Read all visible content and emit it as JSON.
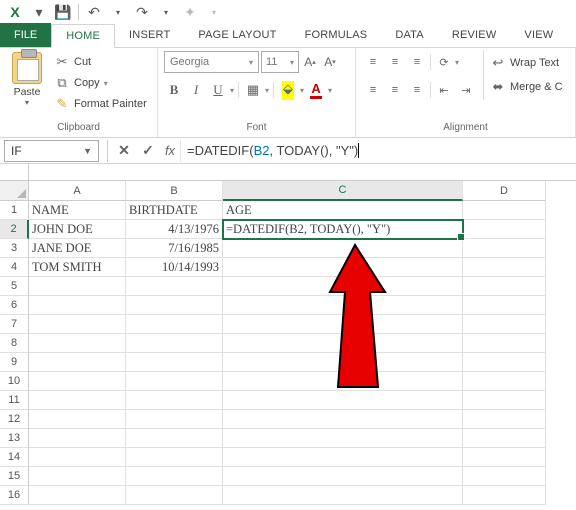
{
  "qat": {
    "excel": "X",
    "save": "💾",
    "undo": "↶",
    "redo": "↷"
  },
  "tabs": {
    "file": "FILE",
    "home": "HOME",
    "insert": "INSERT",
    "page_layout": "PAGE LAYOUT",
    "formulas": "FORMULAS",
    "data": "DATA",
    "review": "REVIEW",
    "view": "VIEW"
  },
  "ribbon": {
    "clipboard": {
      "paste": "Paste",
      "cut": "Cut",
      "copy": "Copy",
      "format_painter": "Format Painter",
      "label": "Clipboard"
    },
    "font": {
      "name": "Georgia",
      "size": "11",
      "label": "Font",
      "bold": "B",
      "italic": "I",
      "underline": "U"
    },
    "alignment": {
      "label": "Alignment",
      "wrap": "Wrap Text",
      "merge": "Merge & C"
    }
  },
  "namebox": "IF",
  "formula_parts": {
    "p1": "=DATEDIF(",
    "ref": "B2",
    "p2": ", TODAY",
    "p3": "()",
    "p4": ", \"Y\"",
    "p5": ")"
  },
  "col_headers": [
    "A",
    "B",
    "C",
    "D"
  ],
  "row_headers": [
    "1",
    "2",
    "3",
    "4",
    "5",
    "6",
    "7",
    "8",
    "9",
    "10",
    "11",
    "12",
    "13",
    "14",
    "15",
    "16"
  ],
  "cells": {
    "A1": "NAME",
    "B1": "BIRTHDATE",
    "C1": "AGE",
    "A2": "JOHN DOE",
    "B2": "4/13/1976",
    "C2": "=DATEDIF(B2, TODAY(), \"Y\")",
    "A3": "JANE DOE",
    "B3": "7/16/1985",
    "A4": "TOM SMITH",
    "B4": "10/14/1993"
  },
  "chart_data": {
    "type": "table",
    "title": "",
    "columns": [
      "NAME",
      "BIRTHDATE",
      "AGE"
    ],
    "rows": [
      [
        "JOHN DOE",
        "4/13/1976",
        "=DATEDIF(B2, TODAY(), \"Y\")"
      ],
      [
        "JANE DOE",
        "7/16/1985",
        ""
      ],
      [
        "TOM SMITH",
        "10/14/1993",
        ""
      ]
    ]
  }
}
